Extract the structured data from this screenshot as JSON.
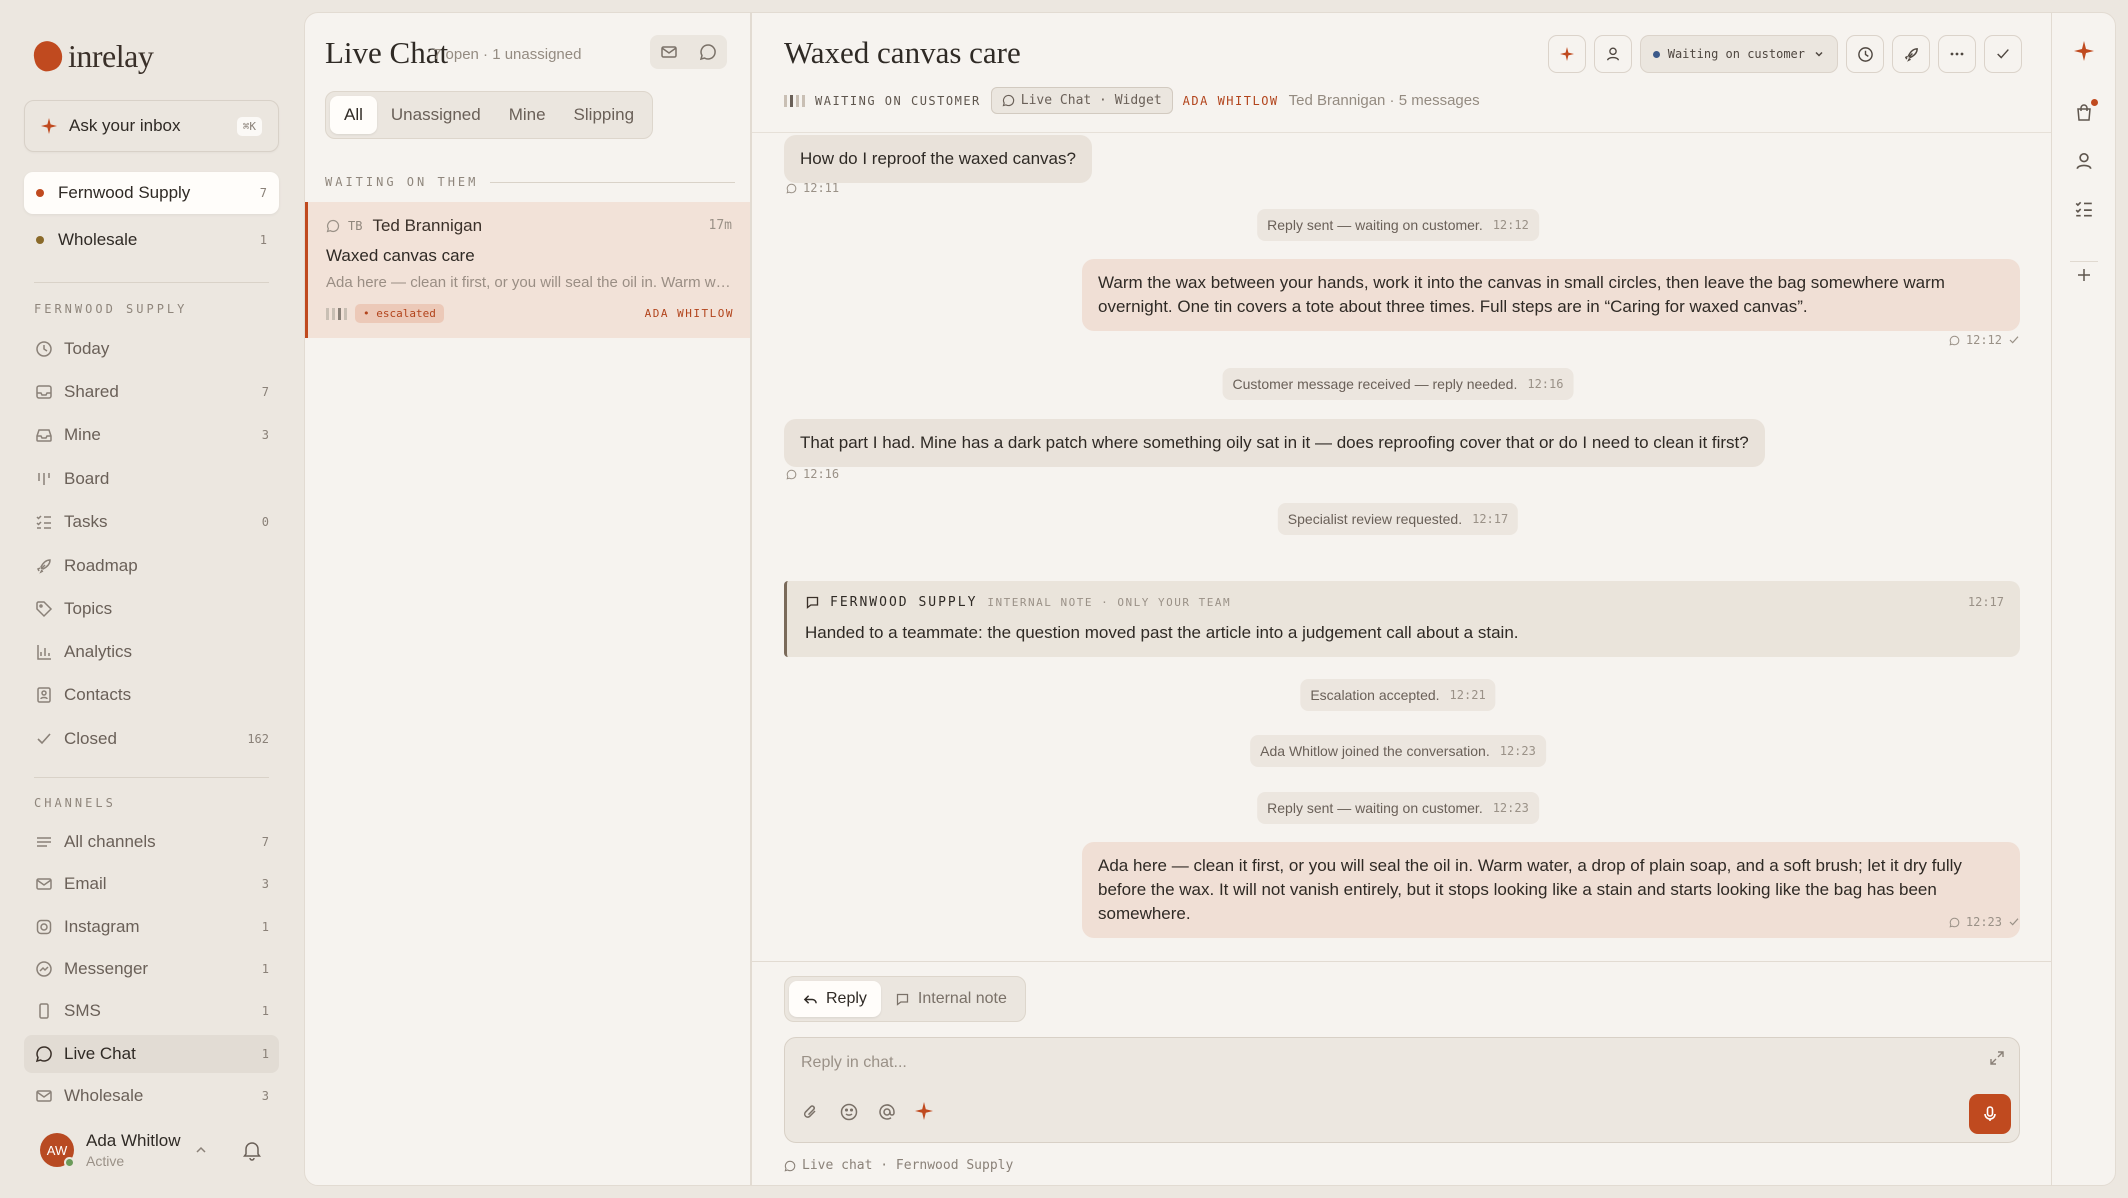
{
  "brand": {
    "name": "inrelay"
  },
  "ask": {
    "label": "Ask your inbox",
    "shortcut": "⌘K"
  },
  "workspaces": [
    {
      "label": "Fernwood Supply",
      "count": "7",
      "color": "#c04a1f",
      "active": true
    },
    {
      "label": "Wholesale",
      "count": "1",
      "color": "#8a6a2a",
      "active": false
    }
  ],
  "sidebar": {
    "section_workspace": "FERNWOOD SUPPLY",
    "nav": [
      {
        "label": "Today",
        "count": "",
        "icon": "clock-icon"
      },
      {
        "label": "Shared",
        "count": "7",
        "icon": "inbox-icon"
      },
      {
        "label": "Mine",
        "count": "3",
        "icon": "tray-icon"
      },
      {
        "label": "Board",
        "count": "",
        "icon": "board-icon"
      },
      {
        "label": "Tasks",
        "count": "0",
        "icon": "tasks-icon"
      },
      {
        "label": "Roadmap",
        "count": "",
        "icon": "rocket-icon"
      },
      {
        "label": "Topics",
        "count": "",
        "icon": "tag-icon"
      },
      {
        "label": "Analytics",
        "count": "",
        "icon": "chart-icon"
      },
      {
        "label": "Contacts",
        "count": "",
        "icon": "contact-icon"
      },
      {
        "label": "Closed",
        "count": "162",
        "icon": "check-icon"
      }
    ],
    "section_channels": "CHANNELS",
    "channels": [
      {
        "label": "All channels",
        "count": "7",
        "icon": "lines-icon"
      },
      {
        "label": "Email",
        "count": "3",
        "icon": "mail-icon"
      },
      {
        "label": "Instagram",
        "count": "1",
        "icon": "instagram-icon"
      },
      {
        "label": "Messenger",
        "count": "1",
        "icon": "messenger-icon"
      },
      {
        "label": "SMS",
        "count": "1",
        "icon": "phone-icon"
      },
      {
        "label": "Live Chat",
        "count": "1",
        "icon": "chat-icon",
        "active": true
      },
      {
        "label": "Wholesale",
        "count": "3",
        "icon": "mail-icon"
      }
    ]
  },
  "user": {
    "initials": "AW",
    "name": "Ada Whitlow",
    "status": "Active"
  },
  "list": {
    "title": "Live Chat",
    "subtitle": "7 open · 1 unassigned",
    "tabs": [
      "All",
      "Unassigned",
      "Mine",
      "Slipping"
    ],
    "active_tab": "All",
    "group_label": "WAITING ON THEM",
    "conversation": {
      "initials": "TB",
      "name": "Ted Brannigan",
      "time": "17m",
      "subject": "Waxed canvas care",
      "preview": "Ada here — clean it first, or you will seal the oil in. Warm water, a drop of plain soap, and a soft brush; let it dry fully before the wax.",
      "badge": "• escalated",
      "assignee": "ADA WHITLOW"
    }
  },
  "thread": {
    "title": "Waxed canvas care",
    "status": "WAITING ON CUSTOMER",
    "channel": "Live Chat · Widget",
    "agent": "ADA WHITLOW",
    "customer": "Ted Brannigan · 5 messages",
    "status_select": "Waiting on customer",
    "messages": [
      {
        "type": "in",
        "text": "How do I reproof the waxed canvas?",
        "time": "12:11"
      },
      {
        "type": "sys",
        "text": "Reply sent — waiting on customer.",
        "time": "12:12"
      },
      {
        "type": "out",
        "text": "Warm the wax between your hands, work it into the canvas in small circles, then leave the bag somewhere warm overnight. One tin covers a tote about three times. Full steps are in “Caring for waxed canvas”.",
        "time": "12:12"
      },
      {
        "type": "sys",
        "text": "Customer message received — reply needed.",
        "time": "12:16"
      },
      {
        "type": "in",
        "text": "That part I had. Mine has a dark patch where something oily sat in it — does reproofing cover that or do I need to clean it first?",
        "time": "12:16"
      },
      {
        "type": "sys",
        "text": "Specialist review requested.",
        "time": "12:17"
      },
      {
        "type": "note",
        "author": "FERNWOOD SUPPLY",
        "kind": "INTERNAL NOTE · ONLY YOUR TEAM",
        "text": "Handed to a teammate: the question moved past the article into a judgement call about a stain.",
        "time": "12:17"
      },
      {
        "type": "sys",
        "text": "Escalation accepted.",
        "time": "12:21"
      },
      {
        "type": "sys",
        "text": "Ada Whitlow joined the conversation.",
        "time": "12:23"
      },
      {
        "type": "sys",
        "text": "Reply sent — waiting on customer.",
        "time": "12:23"
      },
      {
        "type": "out",
        "text": "Ada here — clean it first, or you will seal the oil in. Warm water, a drop of plain soap, and a soft brush; let it dry fully before the wax. It will not vanish entirely, but it stops looking like a stain and starts looking like the bag has been somewhere.",
        "time": "12:23"
      }
    ]
  },
  "composer": {
    "reply_tab": "Reply",
    "note_tab": "Internal note",
    "placeholder": "Reply in chat...",
    "footer": "Live chat · Fernwood Supply"
  }
}
